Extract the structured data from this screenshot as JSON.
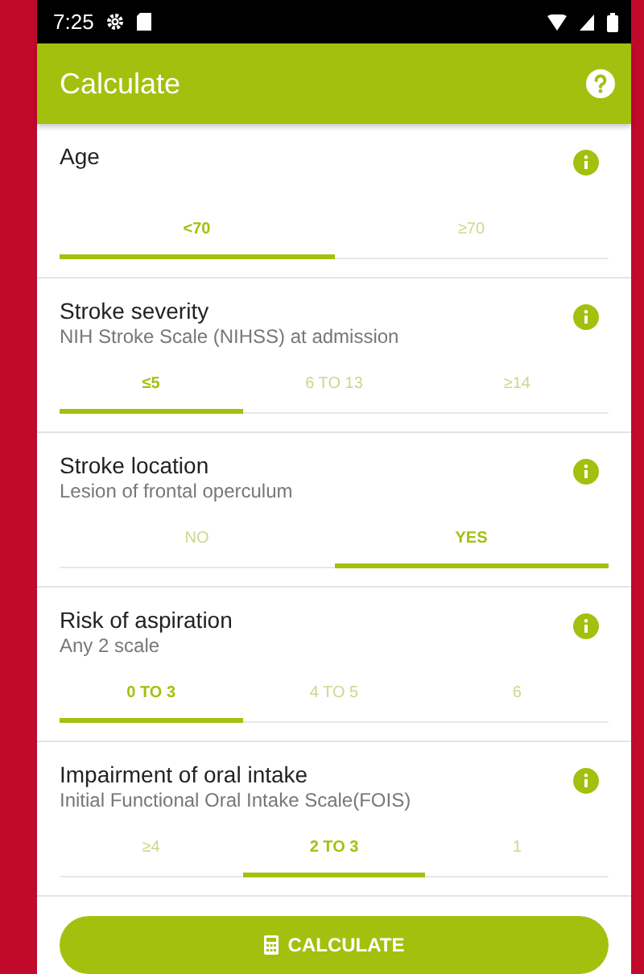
{
  "status_bar": {
    "time": "7:25"
  },
  "app_bar": {
    "title": "Calculate"
  },
  "sections": [
    {
      "title": "Age",
      "options": [
        {
          "label": "<70",
          "selected": true
        },
        {
          "label": "≥70",
          "selected": false
        }
      ]
    },
    {
      "title": "Stroke severity",
      "subtitle": "NIH Stroke Scale (NIHSS) at admission",
      "options": [
        {
          "label": "≤5",
          "selected": true
        },
        {
          "label": "6 TO 13",
          "selected": false
        },
        {
          "label": "≥14",
          "selected": false
        }
      ]
    },
    {
      "title": "Stroke location",
      "subtitle": "Lesion of frontal operculum",
      "options": [
        {
          "label": "NO",
          "selected": false
        },
        {
          "label": "YES",
          "selected": true
        }
      ]
    },
    {
      "title": "Risk of aspiration",
      "subtitle": "Any 2 scale",
      "options": [
        {
          "label": "0 TO 3",
          "selected": true
        },
        {
          "label": "4 TO 5",
          "selected": false
        },
        {
          "label": "6",
          "selected": false
        }
      ]
    },
    {
      "title": "Impairment of oral intake",
      "subtitle": "Initial Functional Oral Intake Scale(FOIS)",
      "options": [
        {
          "label": "≥4",
          "selected": false
        },
        {
          "label": "2 TO 3",
          "selected": true
        },
        {
          "label": "1",
          "selected": false
        }
      ]
    }
  ],
  "calculate_button": {
    "label": "CALCULATE"
  }
}
